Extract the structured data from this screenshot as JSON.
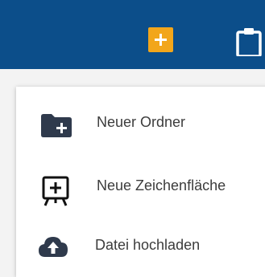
{
  "toolbar": {
    "add_icon": "plus-square-icon",
    "clipboard_icon": "clipboard-icon",
    "add_button_color": "#f2a61b",
    "bar_color": "#0c4e8a"
  },
  "menu": {
    "items": [
      {
        "label": "Neuer Ordner",
        "icon": "folder-plus-icon"
      },
      {
        "label": "Neue Zeichenfläche",
        "icon": "whiteboard-icon"
      },
      {
        "label": "Datei hochladen",
        "icon": "cloud-upload-icon"
      }
    ]
  }
}
